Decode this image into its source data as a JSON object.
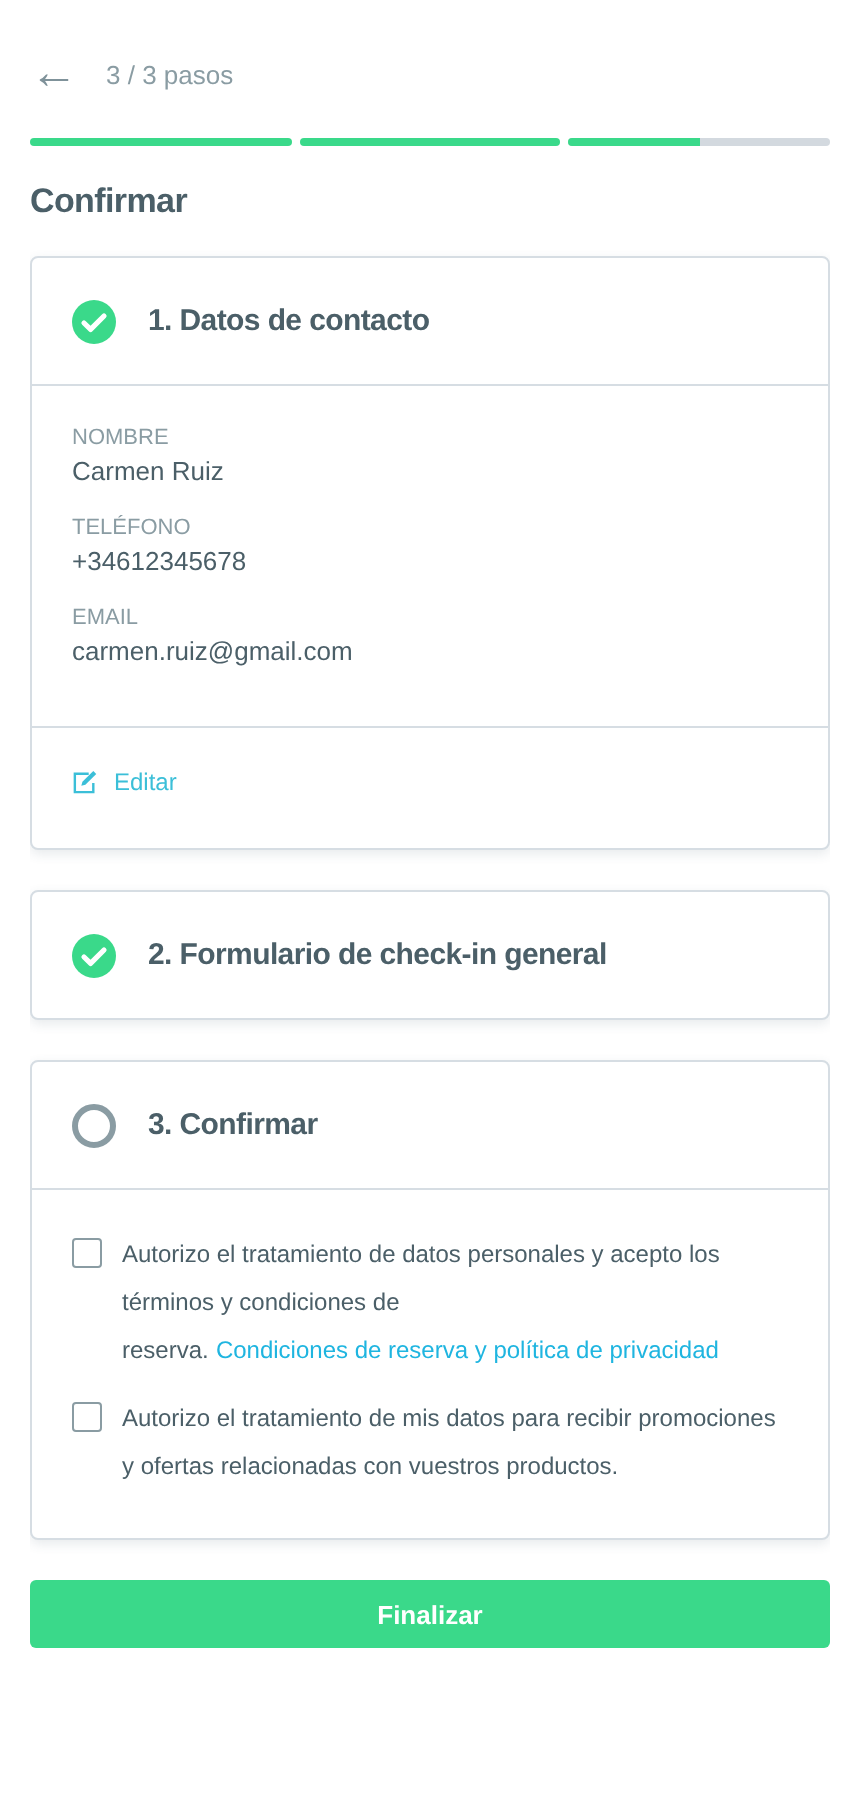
{
  "header": {
    "back": "←",
    "steps": "3 / 3 pasos"
  },
  "progress": [
    {
      "level": 1
    },
    {
      "level": 1
    },
    {
      "level": 0.5
    }
  ],
  "title": "Confirmar",
  "sections": [
    {
      "kind": "contact",
      "title": "1. Datos de contacto",
      "completed": true,
      "fields": [
        {
          "label": "NOMBRE",
          "value": "Carmen Ruiz"
        },
        {
          "label": "TELÉFONO",
          "value": "+34612345678"
        },
        {
          "label": "EMAIL",
          "value": "carmen.ruiz@gmail.com"
        }
      ],
      "edit": "Editar"
    },
    {
      "kind": "collapsed",
      "title": "2. Formulario de check-in general",
      "completed": true
    },
    {
      "kind": "consent",
      "title": "3. Confirmar",
      "completed": false,
      "consents": [
        {
          "text": "Autorizo el tratamiento de datos personales y acepto los términos y condiciones de reserva.",
          "link": "Condiciones de reserva y política de privacidad",
          "checked": false
        },
        {
          "text": "Autorizo el tratamiento de mis datos para recibir promociones y ofertas relacionadas con vuestros productos.",
          "checked": false
        }
      ]
    }
  ],
  "button": "Finalizar"
}
